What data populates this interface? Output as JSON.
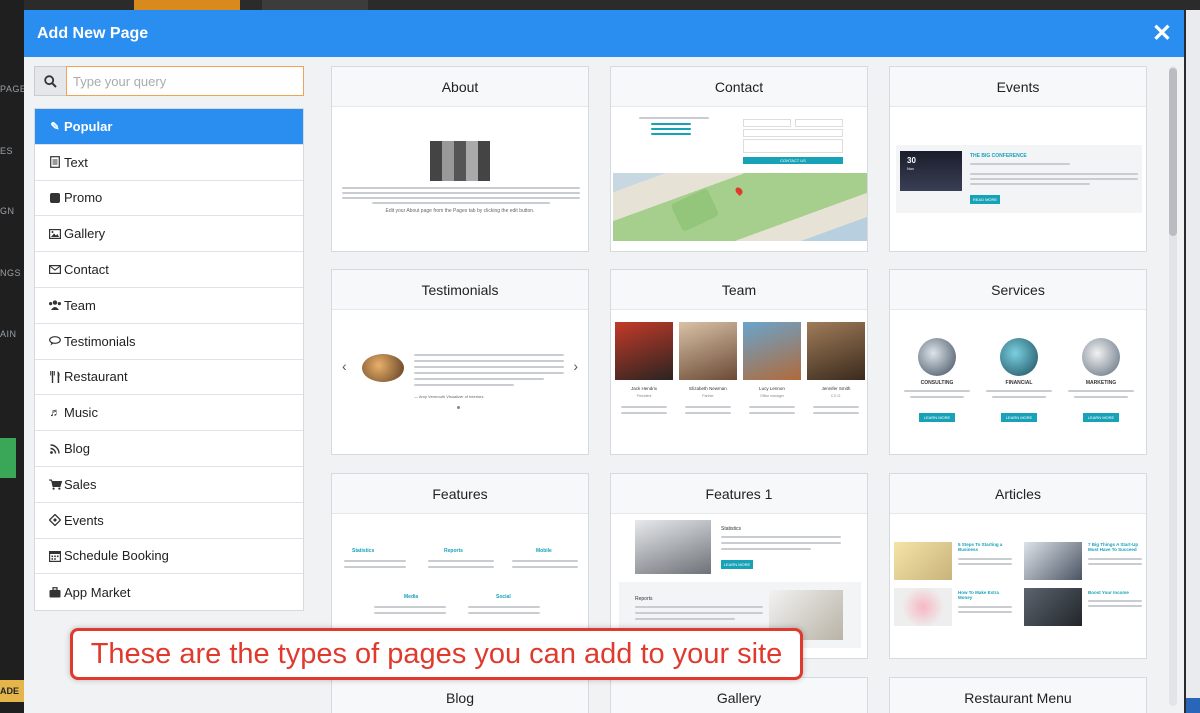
{
  "background": {
    "rail_labels": [
      "PAGE",
      "ES",
      "GN",
      "NGS",
      "AIN"
    ],
    "rail_button": "ADE"
  },
  "modal": {
    "title": "Add New Page",
    "close_icon": "close-icon"
  },
  "search": {
    "placeholder": "Type your query",
    "icon": "search-icon"
  },
  "categories": [
    {
      "label": "Popular",
      "icon": "tag-icon",
      "active": true
    },
    {
      "label": "Text",
      "icon": "file-text-icon"
    },
    {
      "label": "Promo",
      "icon": "square-icon"
    },
    {
      "label": "Gallery",
      "icon": "image-icon"
    },
    {
      "label": "Contact",
      "icon": "envelope-icon"
    },
    {
      "label": "Team",
      "icon": "users-icon"
    },
    {
      "label": "Testimonials",
      "icon": "comments-icon"
    },
    {
      "label": "Restaurant",
      "icon": "cutlery-icon"
    },
    {
      "label": "Music",
      "icon": "music-icon"
    },
    {
      "label": "Blog",
      "icon": "rss-icon"
    },
    {
      "label": "Sales",
      "icon": "cart-icon"
    },
    {
      "label": "Events",
      "icon": "ticket-icon"
    },
    {
      "label": "Schedule Booking",
      "icon": "calendar-icon"
    },
    {
      "label": "App Market",
      "icon": "briefcase-icon"
    }
  ],
  "cards": [
    {
      "title": "About",
      "caption": "Edit your About page from the Pages tab by clicking the edit button."
    },
    {
      "title": "Contact",
      "button": "CONTACT US"
    },
    {
      "title": "Events",
      "heading": "THE BIG CONFERENCE",
      "date": "30",
      "month": "Nov",
      "button": "READ MORE"
    },
    {
      "title": "Testimonials",
      "author": "— Amy Vermouth Visualizer of Interiors"
    },
    {
      "title": "Team",
      "members": [
        {
          "name": "Jack Hendrix",
          "role": "President"
        },
        {
          "name": "Elizabeth Newman",
          "role": "Partner"
        },
        {
          "name": "Lucy Lennon",
          "role": "Office manager"
        },
        {
          "name": "Jennifer Smith",
          "role": "C.E.O."
        }
      ]
    },
    {
      "title": "Services",
      "items": [
        {
          "label": "CONSULTING",
          "button": "LEARN MORE"
        },
        {
          "label": "FINANCIAL",
          "button": "LEARN MORE"
        },
        {
          "label": "MARKETING",
          "button": "LEARN MORE"
        }
      ]
    },
    {
      "title": "Features",
      "items": [
        "Statistics",
        "Reports",
        "Mobile",
        "Media",
        "Social"
      ]
    },
    {
      "title": "Features 1",
      "items": [
        "Statistics",
        "Reports"
      ],
      "button": "LEARN MORE"
    },
    {
      "title": "Articles",
      "items": [
        "5 Steps To Starting a Business",
        "7 Big Things A Start-Up Must Have To Succeed",
        "How To Make Extra Money",
        "Boost Your Income"
      ]
    },
    {
      "title": "Blog"
    },
    {
      "title": "Gallery"
    },
    {
      "title": "Restaurant Menu"
    }
  ],
  "callout": {
    "text": "These are the types of pages you can add to your site"
  },
  "colors": {
    "header_blue": "#2a8ef0",
    "callout_red": "#e03a2e",
    "teal": "#17a2b8"
  }
}
